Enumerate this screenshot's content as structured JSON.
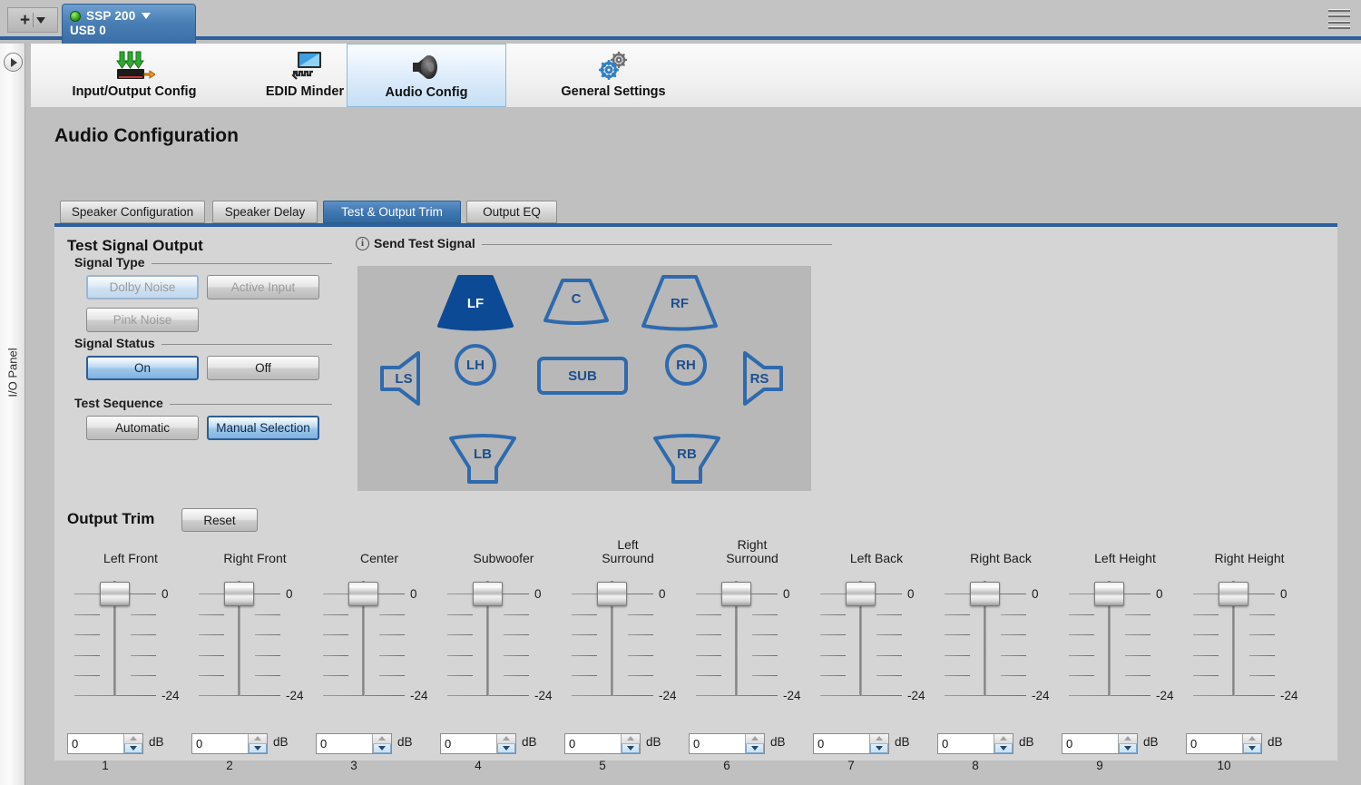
{
  "window": {
    "add_button_label": "+",
    "menu_icon": "hamburger-icon"
  },
  "device_tab": {
    "name": "SSP 200",
    "connection": "USB 0",
    "status_indicator": "green-led",
    "accent": "#3a6ea5"
  },
  "io_panel": {
    "label": "I/O Panel",
    "toggle_icon": "chevron-right-icon"
  },
  "ribbon": {
    "items": [
      {
        "label": "Input/Output Config",
        "icon": "input-output-icon",
        "active": false
      },
      {
        "label": "EDID Minder",
        "icon": "display-edid-icon",
        "active": false
      },
      {
        "label": "Audio Config",
        "icon": "speaker-icon",
        "active": true
      },
      {
        "label": "General Settings",
        "icon": "gears-icon",
        "active": false
      }
    ]
  },
  "page": {
    "title": "Audio Configuration",
    "accent": "#2c5f9e"
  },
  "tabs": [
    {
      "label": "Speaker Configuration",
      "active": false
    },
    {
      "label": "Speaker Delay",
      "active": false
    },
    {
      "label": "Test & Output Trim",
      "active": true
    },
    {
      "label": "Output EQ",
      "active": false
    }
  ],
  "test_signal_output": {
    "title": "Test Signal Output",
    "signal_type": {
      "legend": "Signal Type",
      "options": [
        {
          "label": "Dolby Noise",
          "selected": true,
          "disabled": true
        },
        {
          "label": "Active Input",
          "selected": false,
          "disabled": true
        },
        {
          "label": "Pink Noise",
          "selected": false,
          "disabled": true
        }
      ]
    },
    "signal_status": {
      "legend": "Signal Status",
      "options": [
        {
          "label": "On",
          "selected": true,
          "disabled": false
        },
        {
          "label": "Off",
          "selected": false,
          "disabled": false
        }
      ]
    },
    "test_sequence": {
      "legend": "Test Sequence",
      "options": [
        {
          "label": "Automatic",
          "selected": false,
          "disabled": false
        },
        {
          "label": "Manual Selection",
          "selected": true,
          "disabled": false
        }
      ]
    }
  },
  "send_test_signal": {
    "legend": "Send Test Signal",
    "info_icon": "info-icon",
    "selected_speaker": "LF",
    "speaker_outline_color": "#2e6aad",
    "speaker_selected_fill": "#0d4a96",
    "speakers": [
      {
        "id": "LF",
        "label": "LF",
        "shape": "trapezoid-front",
        "selected": true
      },
      {
        "id": "C",
        "label": "C",
        "shape": "trapezoid-front",
        "selected": false
      },
      {
        "id": "RF",
        "label": "RF",
        "shape": "trapezoid-front",
        "selected": false
      },
      {
        "id": "LH",
        "label": "LH",
        "shape": "circle",
        "selected": false
      },
      {
        "id": "RH",
        "label": "RH",
        "shape": "circle",
        "selected": false
      },
      {
        "id": "SUB",
        "label": "SUB",
        "shape": "rectangle",
        "selected": false
      },
      {
        "id": "LS",
        "label": "LS",
        "shape": "cone-right",
        "selected": false
      },
      {
        "id": "RS",
        "label": "RS",
        "shape": "cone-left",
        "selected": false
      },
      {
        "id": "LB",
        "label": "LB",
        "shape": "trapezoid-back",
        "selected": false
      },
      {
        "id": "RB",
        "label": "RB",
        "shape": "trapezoid-back",
        "selected": false
      }
    ]
  },
  "output_trim": {
    "title": "Output Trim",
    "reset_label": "Reset",
    "unit": "dB",
    "scale_top_label": "0",
    "scale_bottom_label": "-24",
    "range": [
      -24,
      0
    ],
    "channels": [
      {
        "number": "1",
        "name": "Left Front",
        "value": "0"
      },
      {
        "number": "2",
        "name": "Right Front",
        "value": "0"
      },
      {
        "number": "3",
        "name": "Center",
        "value": "0"
      },
      {
        "number": "4",
        "name": "Subwoofer",
        "value": "0"
      },
      {
        "number": "5",
        "name": "Left\nSurround",
        "value": "0"
      },
      {
        "number": "6",
        "name": "Right\nSurround",
        "value": "0"
      },
      {
        "number": "7",
        "name": "Left Back",
        "value": "0"
      },
      {
        "number": "8",
        "name": "Right Back",
        "value": "0"
      },
      {
        "number": "9",
        "name": "Left Height",
        "value": "0"
      },
      {
        "number": "10",
        "name": "Right Height",
        "value": "0"
      }
    ]
  }
}
